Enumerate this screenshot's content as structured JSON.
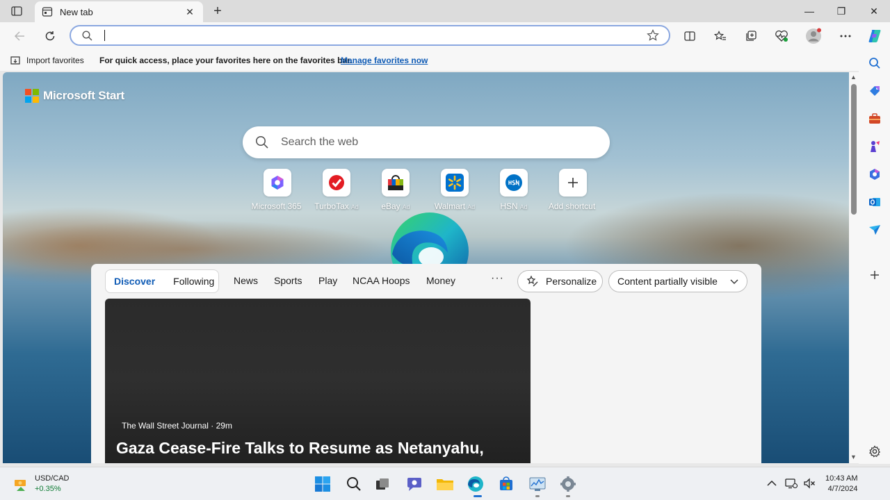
{
  "tab": {
    "title": "New tab",
    "close": "✕",
    "new": "+"
  },
  "window": {
    "minimize": "—",
    "restore": "❐",
    "close": "✕"
  },
  "address": {
    "value": "",
    "placeholder": ""
  },
  "favorites_bar": {
    "import_label": "Import favorites",
    "hint": "For quick access, place your favorites here on the favorites bar.",
    "manage_link": "Manage favorites now"
  },
  "start": {
    "brand": "Microsoft Start",
    "search_placeholder": "Search the web",
    "shortcuts": [
      {
        "label": "Microsoft 365",
        "ad": "",
        "tile_color": "#7b61ff"
      },
      {
        "label": "TurboTax",
        "ad": "Ad",
        "tile_color": "#e31c23"
      },
      {
        "label": "eBay",
        "ad": "Ad",
        "tile_color": "#0064d2"
      },
      {
        "label": "Walmart",
        "ad": "Ad",
        "tile_color": "#0071ce"
      },
      {
        "label": "HSN",
        "ad": "Ad",
        "tile_color": "#0072c6"
      },
      {
        "label": "Add shortcut",
        "ad": "",
        "tile_color": "#333333"
      }
    ]
  },
  "feed": {
    "tabs": [
      "Discover",
      "Following"
    ],
    "nav": [
      "News",
      "Sports",
      "Play",
      "NCAA Hoops",
      "Money"
    ],
    "more": "···",
    "personalize": "Personalize",
    "visibility": "Content partially visible",
    "card": {
      "source": "The Wall Street Journal · 29m",
      "headline": "Gaza Cease-Fire Talks to Resume as Netanyahu,"
    }
  },
  "taskbar": {
    "ticker": {
      "symbol": "USD/CAD",
      "change": "+0.35%"
    },
    "time": "10:43 AM",
    "date": "4/7/2024"
  },
  "colors": {
    "accent": "#0f5bb5",
    "address_border": "#8aa7e0",
    "ticker_up": "#0c7a32"
  }
}
